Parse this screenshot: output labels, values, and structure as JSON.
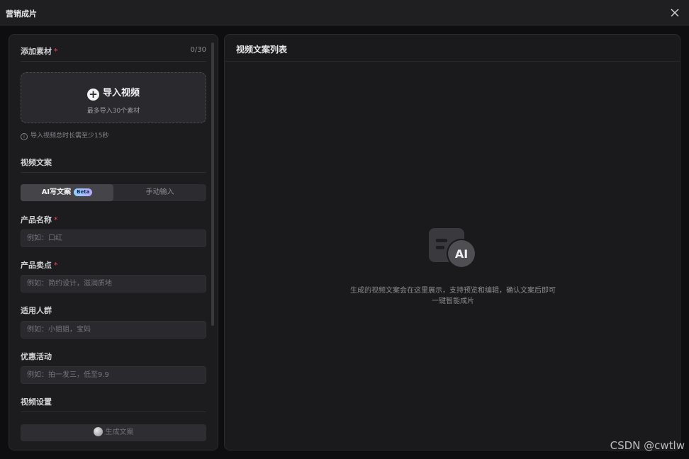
{
  "window": {
    "title": "营销成片"
  },
  "material": {
    "heading": "添加素材",
    "required_mark": "*",
    "count": "0/30",
    "upload_title": "导入视频",
    "upload_sub": "最多导入30个素材",
    "tip": "导入视频总时长需至少15秒"
  },
  "copy": {
    "heading": "视频文案",
    "tabs": [
      {
        "label": "AI写文案",
        "badge": "Beta"
      },
      {
        "label": "手动输入"
      }
    ]
  },
  "fields": [
    {
      "label": "产品名称",
      "required": "*",
      "placeholder": "例如：口红"
    },
    {
      "label": "产品卖点",
      "required": "*",
      "placeholder": "例如：简约设计，滋润质地"
    },
    {
      "label": "适用人群",
      "placeholder": "例如：小姐姐，宝妈"
    },
    {
      "label": "优惠活动",
      "placeholder": "例如：拍一发三，低至9.9"
    }
  ],
  "video_settings": {
    "heading": "视频设置"
  },
  "generate": {
    "label": "生成文案"
  },
  "right": {
    "heading": "视频文案列表",
    "empty_line1": "生成的视频文案会在这里展示，支持预览和编辑，确认文案后即可",
    "empty_line2": "一键智能成片",
    "illus_text": "AI"
  },
  "watermark": "CSDN @cwtlw",
  "icons": [
    "close-icon",
    "plus-circle-icon",
    "info-icon",
    "ai-document-icon",
    "spinner-icon"
  ]
}
